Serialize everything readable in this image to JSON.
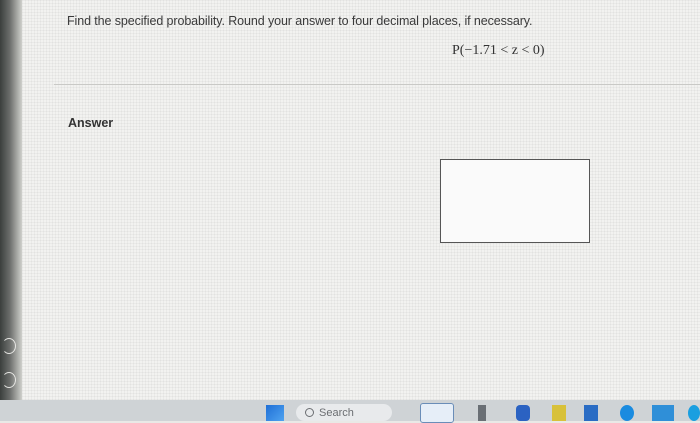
{
  "question": {
    "prompt": "Find the specified probability. Round your answer to four decimal places, if necessary.",
    "expression": "P(−1.71 < z < 0)"
  },
  "answer": {
    "label": "Answer",
    "value": ""
  },
  "taskbar": {
    "search_label": "Search",
    "icons": [
      "start-icon",
      "widgets-icon",
      "app-icon",
      "app-icon",
      "app-icon",
      "app-icon",
      "app-icon",
      "app-icon",
      "app-icon"
    ]
  }
}
